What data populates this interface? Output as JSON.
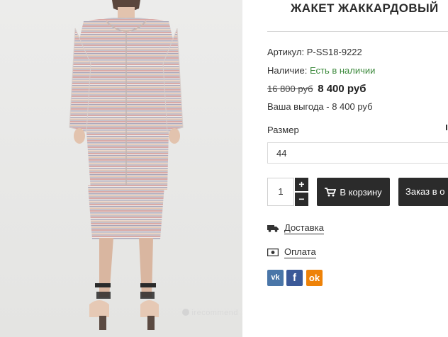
{
  "product": {
    "title": "ЖАКЕТ ЖАККАРДОВЫЙ",
    "sku_label": "Артикул:",
    "sku_value": "P-SS18-9222",
    "availability_label": "Наличие:",
    "availability_value": "Есть в наличии",
    "old_price": "16 800 руб",
    "new_price": "8 400 руб",
    "profit_text": "Ваша выгода - 8 400 руб",
    "size_label": "Размер",
    "size_value": "44"
  },
  "purchase": {
    "quantity": "1",
    "plus": "+",
    "minus": "−",
    "add_to_cart": "В корзину",
    "order_label": "Заказ в о"
  },
  "links": {
    "delivery": "Доставка",
    "payment": "Оплата"
  },
  "socials": {
    "vk": "vk",
    "fb": "f",
    "ok": "ok"
  },
  "watermark": "irecommend",
  "colors": {
    "button_dark": "#2b2b2b",
    "in_stock_green": "#3d8a3d",
    "vk_blue": "#4a76a8",
    "fb_blue": "#3b5998",
    "ok_orange": "#ee8208"
  }
}
